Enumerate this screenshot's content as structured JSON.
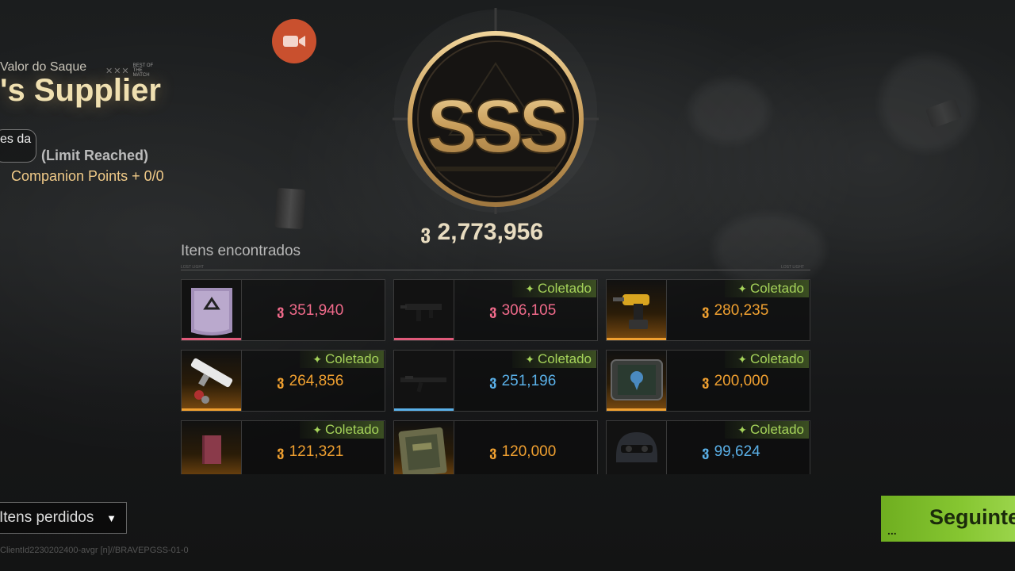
{
  "header": {
    "loot_value_label": "Valor do Saque",
    "best_of_match": "BEST OF THE MATCH",
    "title": "'s Supplier",
    "chip_text": "es da",
    "limit_text": "(Limit Reached)",
    "companion_points": "Companion Points + 0/0"
  },
  "rank": {
    "grade": "SSS",
    "total_value": "2,773,956"
  },
  "found": {
    "label": "Itens encontrados",
    "tag_left": "LOST LIGHT",
    "tag_right": "LOST LIGHT",
    "collected_label": "Coletado",
    "items": [
      {
        "icon": "armor-plate",
        "value": "351,940",
        "collected": false,
        "value_color": "#f06a8a",
        "rarity_color": "#e05a7a"
      },
      {
        "icon": "smg-weapon",
        "value": "306,105",
        "collected": true,
        "value_color": "#f06a8a",
        "rarity_color": "#e05a7a"
      },
      {
        "icon": "power-drill",
        "value": "280,235",
        "collected": true,
        "value_color": "#f0a030",
        "rarity_color": "#f0a030"
      },
      {
        "icon": "white-rifle",
        "value": "264,856",
        "collected": true,
        "value_color": "#f0a030",
        "rarity_color": "#f0a030"
      },
      {
        "icon": "assault-rifle",
        "value": "251,196",
        "collected": true,
        "value_color": "#5ab0e8",
        "rarity_color": "#5ab0e8"
      },
      {
        "icon": "tablet-certificate",
        "value": "200,000",
        "collected": true,
        "value_color": "#f0a030",
        "rarity_color": "#f0a030"
      },
      {
        "icon": "red-book",
        "value": "121,321",
        "collected": true,
        "value_color": "#f0a030",
        "rarity_color": "#f0a030"
      },
      {
        "icon": "military-case",
        "value": "120,000",
        "collected": false,
        "value_color": "#f0a030",
        "rarity_color": "#f0a030"
      },
      {
        "icon": "tactical-helmet",
        "value": "99,624",
        "collected": true,
        "value_color": "#5ab0e8",
        "rarity_color": "#5ab0e8"
      }
    ]
  },
  "footer": {
    "lost_items_label": "Itens perdidos",
    "next_label": "Seguinte",
    "build_info": "ClientId2230202400-avgr [n]//BRAVEPGSS-01-0"
  }
}
